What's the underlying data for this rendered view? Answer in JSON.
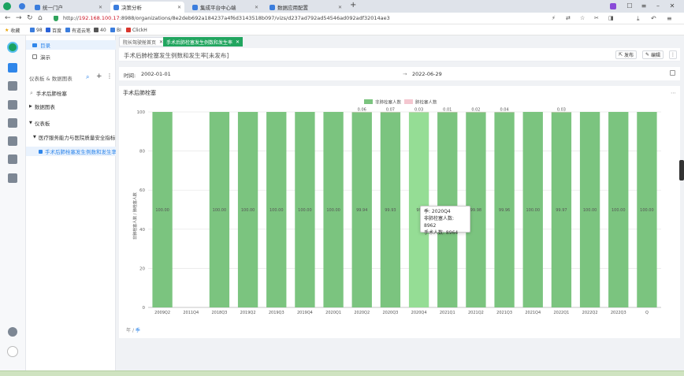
{
  "browser": {
    "tabs": [
      {
        "label": "统一门户",
        "active": false
      },
      {
        "label": "决策分析",
        "active": true
      },
      {
        "label": "集成平台中心端",
        "active": false
      },
      {
        "label": "数据应用配置",
        "active": false
      }
    ],
    "new_tab": "+",
    "url_scheme": "http://",
    "url_host": "192.168.100.17",
    "url_rest": ":8988/organizations/8e2deb692a184237a4f6d3143518b097/vizs/d237ad792ad54546ad092adf32014ae3",
    "bookmarks": [
      "收藏",
      "98",
      "百度",
      "有道云笔",
      "40",
      "BI",
      "ClickH"
    ]
  },
  "nav": {
    "directory_label": "目录",
    "demo_label": "演示",
    "section_label": "仪表板 & 数据图表",
    "search_value": "手术后肺栓塞",
    "tree": [
      {
        "label": "数据图表",
        "level": 0,
        "expanded": false
      },
      {
        "label": "仪表板",
        "level": 0,
        "expanded": true
      },
      {
        "label": "医疗服务能力与医院质量安全指标",
        "level": 1,
        "expanded": true
      },
      {
        "label": "手术后肺栓塞发生例数和发生率",
        "level": 2,
        "selected": true
      }
    ]
  },
  "content_tabs": [
    {
      "label": "院长驾驶舱首页"
    },
    {
      "label": "手术后肺栓塞发生例数和发生率"
    }
  ],
  "page": {
    "title": "手术后肺栓塞发生例数和发生率[未发布]",
    "publish_label": "发布",
    "edit_label": "编辑",
    "more_label": "⋮"
  },
  "filters": {
    "time_label": "时间:",
    "date_from": "2002-01-01",
    "date_sep": "→",
    "date_to": "2022-06-29"
  },
  "chart_data": {
    "type": "bar",
    "stacked": true,
    "orientation": "vertical",
    "title": "手术后肺栓塞",
    "ylabel": "非肺栓塞人数 / 肺栓塞人数",
    "ylim": [
      0,
      100
    ],
    "yticks": [
      0,
      20,
      40,
      60,
      80,
      100
    ],
    "grid": true,
    "legend_position": "top-center",
    "categories": [
      "2009Q2",
      "2011Q4",
      "2018Q3",
      "2019Q2",
      "2019Q3",
      "2019Q4",
      "2020Q1",
      "2020Q2",
      "2020Q3",
      "2020Q4",
      "2021Q1",
      "2021Q2",
      "2021Q3",
      "2021Q4",
      "2022Q1",
      "2022Q2",
      "2022Q3",
      "Q"
    ],
    "series": [
      {
        "name": "非肺栓塞人数",
        "color": "#7bc47f",
        "values": [
          100.0,
          0,
          100.0,
          100.0,
          100.0,
          100.0,
          100.0,
          99.94,
          99.93,
          99.97,
          99.99,
          99.98,
          99.96,
          100.0,
          99.97,
          100.0,
          100.0,
          100.0
        ],
        "labels": [
          "100.00",
          "",
          "100.00",
          "100.00",
          "100.00",
          "100.00",
          "100.00",
          "99.94",
          "99.93",
          "99",
          "",
          "99.98",
          "99.96",
          "100.00",
          "99.97",
          "100.00",
          "100.00",
          "100.00"
        ]
      },
      {
        "name": "肺栓塞人数",
        "color": "#f4c7d0",
        "values": [
          0,
          0,
          0,
          0,
          0,
          0,
          0,
          0.06,
          0.07,
          0.03,
          0.01,
          0.02,
          0.04,
          0,
          0.03,
          0,
          0,
          0
        ],
        "labels": [
          "",
          "",
          "",
          "",
          "",
          "",
          "",
          "0.06",
          "0.07",
          "0.03",
          "0.01",
          "0.02",
          "0.04",
          "",
          "0.03",
          "",
          "",
          ""
        ]
      }
    ],
    "highlighted_index": 9,
    "highlight_color": "#95dd95"
  },
  "tooltip": {
    "line1": "季: 2020Q4",
    "line2": "非肺栓塞人数: 8962",
    "line3": "手术人数: 8964"
  },
  "drill_path": {
    "item1": "年",
    "sep": "/",
    "item2": "季"
  }
}
